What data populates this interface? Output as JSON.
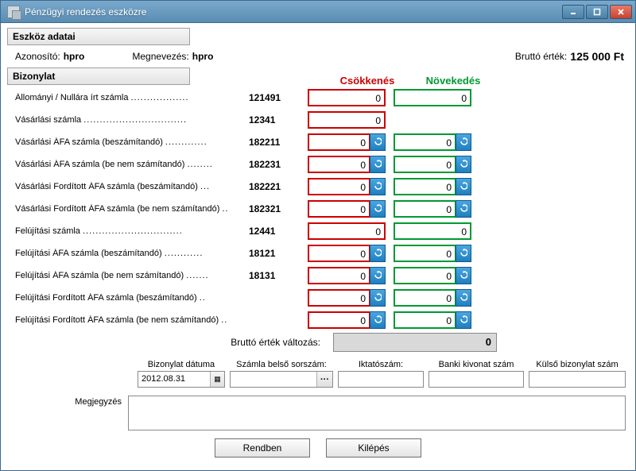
{
  "window": {
    "title": "Pénzügyi rendezés eszközre"
  },
  "section1": {
    "title": "Eszköz adatai"
  },
  "asset": {
    "id_label": "Azonosító:",
    "id_value": "hpro",
    "name_label": "Megnevezés:",
    "name_value": "hpro",
    "brutto_label": "Bruttó érték:",
    "brutto_value": "125 000 Ft"
  },
  "section2": {
    "title": "Bizonylat"
  },
  "cols": {
    "decrease": "Csökkenés",
    "increase": "Növekedés"
  },
  "rows": [
    {
      "label": "Állományi / Nullára írt számla",
      "code": "121491",
      "dec": "0",
      "inc": "0",
      "dec_btn": false,
      "inc_btn": false
    },
    {
      "label": "Vásárlási számla",
      "code": "12341",
      "dec": "0",
      "inc": "",
      "dec_btn": false,
      "inc_btn": false,
      "no_inc": true
    },
    {
      "label": "Vásárlási ÁFA számla (beszámítandó)",
      "code": "182211",
      "dec": "0",
      "inc": "0",
      "dec_btn": true,
      "inc_btn": true
    },
    {
      "label": "Vásárlási ÁFA számla (be nem számítandó)",
      "code": "182231",
      "dec": "0",
      "inc": "0",
      "dec_btn": true,
      "inc_btn": true
    },
    {
      "label": "Vásárlási Fordított ÁFA számla (beszámítandó)",
      "code": "182221",
      "dec": "0",
      "inc": "0",
      "dec_btn": true,
      "inc_btn": true
    },
    {
      "label": "Vásárlási Fordított ÁFA számla (be nem számítandó)",
      "code": "182321",
      "dec": "0",
      "inc": "0",
      "dec_btn": true,
      "inc_btn": true
    },
    {
      "label": "Felújítási számla",
      "code": "12441",
      "dec": "0",
      "inc": "0",
      "dec_btn": false,
      "inc_btn": false
    },
    {
      "label": "Felújítási ÁFA számla (beszámítandó)",
      "code": "18121",
      "dec": "0",
      "inc": "0",
      "dec_btn": true,
      "inc_btn": true
    },
    {
      "label": "Felújítási ÁFA számla (be nem számítandó)",
      "code": "18131",
      "dec": "0",
      "inc": "0",
      "dec_btn": true,
      "inc_btn": true
    },
    {
      "label": "Felújítási Fordított ÁFA számla (beszámítandó)",
      "code": "",
      "dec": "0",
      "inc": "0",
      "dec_btn": true,
      "inc_btn": true
    },
    {
      "label": "Felújítási Fordított ÁFA számla (be nem számítandó)",
      "code": "",
      "dec": "0",
      "inc": "0",
      "dec_btn": true,
      "inc_btn": true
    }
  ],
  "total": {
    "label": "Bruttó érték változás:",
    "value": "0"
  },
  "form": {
    "date_label": "Bizonylat dátuma",
    "date_value": "2012.08.31",
    "sorsz_label": "Számla belső sorszám:",
    "sorsz_value": "",
    "iktato_label": "Iktatószám:",
    "iktato_value": "",
    "banki_label": "Banki kivonat szám",
    "banki_value": "",
    "kulso_label": "Külső bizonylat szám",
    "kulso_value": "",
    "memo_label": "Megjegyzés",
    "memo_value": ""
  },
  "buttons": {
    "ok": "Rendben",
    "cancel": "Kilépés"
  }
}
